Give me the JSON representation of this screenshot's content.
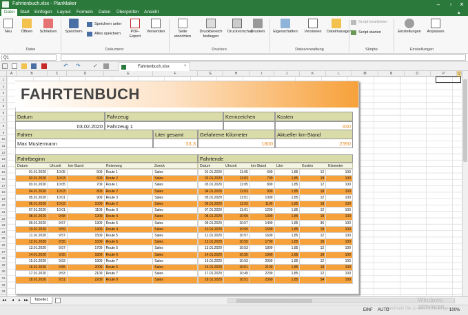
{
  "window": {
    "title": "Fahrtenbuch.xlsx - PlanMaker"
  },
  "menu": [
    "Datei",
    "Start",
    "Einfügen",
    "Layout",
    "Formeln",
    "Daten",
    "Überprüfen",
    "Ansicht"
  ],
  "ribbon": {
    "datei": {
      "neu": "Neu",
      "oeffnen": "Öffnen",
      "schliessen": "Schließen",
      "label": "Datei"
    },
    "dokument": {
      "speichern": "Speichern",
      "speichern_unter": "Speichern unter",
      "alles_speichern": "Alles speichern",
      "pdf": "PDF-Export",
      "versenden": "Versenden",
      "label": "Dokument"
    },
    "drucken": {
      "seite": "Seite einrichten",
      "druckbereich": "Druckbereich festlegen",
      "druckvorschau": "Druckvorschau",
      "drucken": "Drucken",
      "label": "Drucken"
    },
    "dateiverwaltung": {
      "eigenschaften": "Eigenschaften",
      "versionen": "Versionen",
      "dateimanager": "Dateimanager",
      "label": "Dateiverwaltung"
    },
    "skripte": {
      "bearbeiten": "Script bearbeiten",
      "starten": "Script starten",
      "label": "Skripte"
    },
    "einstellungen": {
      "einstellungen": "Einstellungen",
      "anpassen": "Anpassen",
      "label": "Einstellungen"
    }
  },
  "formula": {
    "cellref": "Q1",
    "value": ""
  },
  "doc_tab": "Fahrtenbuch.xlsx",
  "columns": [
    "A",
    "B",
    "C",
    "D",
    "E",
    "F",
    "G",
    "H",
    "I",
    "J",
    "K",
    "L",
    "M",
    "N",
    "O",
    "P",
    "Q"
  ],
  "rows": [
    "1",
    "2",
    "3",
    "4",
    "5",
    "6",
    "7",
    "8",
    "9",
    "10",
    "11",
    "12",
    "13",
    "14",
    "15",
    "16",
    "17",
    "18",
    "19",
    "20",
    "21",
    "22",
    "23",
    "24",
    "25",
    "26",
    "27",
    "28",
    "29",
    "30",
    "31",
    "32",
    "33"
  ],
  "sheet": {
    "title": "FAHRTENBUCH",
    "datum_label": "Datum",
    "datum": "03.02.2020",
    "fahrzeug_label": "Fahrzeug",
    "fahrzeug": "Fahrzeug 1",
    "kennzeichen_label": "Kennzeichen",
    "kosten_label": "Kosten",
    "kosten": "330",
    "fahrer_label": "Fahrer",
    "fahrer": "Max Mustermann",
    "liter_label": "Liter gesamt",
    "liter": "33,3",
    "km_label": "Gefahrene Kilometer",
    "km": "1800",
    "stand_label": "Aktueller km-Stand",
    "stand": "2390",
    "beginn_label": "Fahrtbeginn",
    "ende_label": "Fahrtende",
    "beginn_cols": [
      "Datum",
      "Uhrzeit",
      "km-Stand",
      "Reiseweg",
      "Zweck"
    ],
    "ende_cols": [
      "Datum",
      "Uhrzeit",
      "km-Stand",
      "Liter",
      "Kosten",
      "Kilometer"
    ],
    "beginn_rows": [
      [
        "01.01.2020",
        "10:05",
        "509",
        "Route 1",
        "Sales"
      ],
      [
        "02.01.2020",
        "10:03",
        "609",
        "Route 2",
        "Sales"
      ],
      [
        "03.01.2020",
        "10:05",
        "709",
        "Route 1",
        "Sales"
      ],
      [
        "04.01.2020",
        "10:03",
        "809",
        "Route 2",
        "Sales"
      ],
      [
        "05.01.2020",
        "10:01",
        "909",
        "Route 3",
        "Sales"
      ],
      [
        "06.01.2020",
        "10:03",
        "1009",
        "Route 2",
        "Sales"
      ],
      [
        "07.01.2020",
        "10:01",
        "1109",
        "Route 3",
        "Sales"
      ],
      [
        "08.01.2020",
        "9:58",
        "1209",
        "Route 4",
        "Sales"
      ],
      [
        "09.01.2020",
        "9:57",
        "1309",
        "Route 5",
        "Sales"
      ],
      [
        "10.01.2020",
        "9:59",
        "1409",
        "Route 4",
        "Sales"
      ],
      [
        "11.01.2020",
        "9:57",
        "1509",
        "Route 5",
        "Sales"
      ],
      [
        "12.01.2020",
        "9:55",
        "1609",
        "Route 6",
        "Sales"
      ],
      [
        "13.01.2020",
        "9:57",
        "1709",
        "Route 5",
        "Sales"
      ],
      [
        "14.01.2020",
        "9:55",
        "1809",
        "Route 6",
        "Sales"
      ],
      [
        "15.01.2020",
        "9:53",
        "1909",
        "Route 7",
        "Sales"
      ],
      [
        "16.01.2020",
        "9:55",
        "2009",
        "Route 6",
        "Sales"
      ],
      [
        "17.01.2020",
        "9:53",
        "2109",
        "Route 7",
        "Sales"
      ],
      [
        "18.01.2020",
        "9:51",
        "2209",
        "Route 8",
        "Sales"
      ]
    ],
    "ende_rows": [
      [
        "01.01.2020",
        "11:05",
        "609",
        "1,85",
        "12",
        "100"
      ],
      [
        "02.01.2020",
        "11:03",
        "709",
        "1,85",
        "18",
        "100"
      ],
      [
        "03.01.2020",
        "11:05",
        "809",
        "1,85",
        "12",
        "100"
      ],
      [
        "04.01.2020",
        "11:03",
        "909",
        "1,85",
        "18",
        "100"
      ],
      [
        "05.01.2020",
        "11:01",
        "1009",
        "1,85",
        "12",
        "100"
      ],
      [
        "06.01.2020",
        "11:03",
        "1109",
        "1,85",
        "18",
        "100"
      ],
      [
        "07.01.2020",
        "11:01",
        "1209",
        "1,85",
        "12",
        "100"
      ],
      [
        "08.01.2020",
        "10:59",
        "1309",
        "1,85",
        "18",
        "100"
      ],
      [
        "09.01.2020",
        "10:57",
        "1409",
        "1,85",
        "36",
        "100"
      ],
      [
        "10.01.2020",
        "10:59",
        "1509",
        "1,85",
        "18",
        "100"
      ],
      [
        "11.01.2020",
        "10:57",
        "1609",
        "1,85",
        "12",
        "100"
      ],
      [
        "12.01.2020",
        "10:55",
        "1709",
        "1,85",
        "18",
        "100"
      ],
      [
        "13.01.2020",
        "10:53",
        "1809",
        "1,85",
        "12",
        "100"
      ],
      [
        "14.01.2020",
        "10:55",
        "1909",
        "1,85",
        "18",
        "100"
      ],
      [
        "15.01.2020",
        "10:53",
        "2009",
        "1,85",
        "12",
        "100"
      ],
      [
        "16.01.2020",
        "10:51",
        "2109",
        "1,85",
        "18",
        "100"
      ],
      [
        "17.01.2020",
        "10:49",
        "2209",
        "1,85",
        "12",
        "100"
      ],
      [
        "18.01.2020",
        "10:51",
        "2309",
        "1,85",
        "54",
        "100"
      ]
    ]
  },
  "sheettab": "Tabelle1",
  "status": {
    "mode": "EINF",
    "calc": "AUTO",
    "zoom": "100%",
    "watermark1": "Windows aktivieren",
    "watermark2": "Wechseln Sie zu den Einstellungen"
  },
  "colors": {
    "titlebar": "#2b7a3c",
    "accent": "#f7a13a",
    "header": "#d9dba8"
  }
}
